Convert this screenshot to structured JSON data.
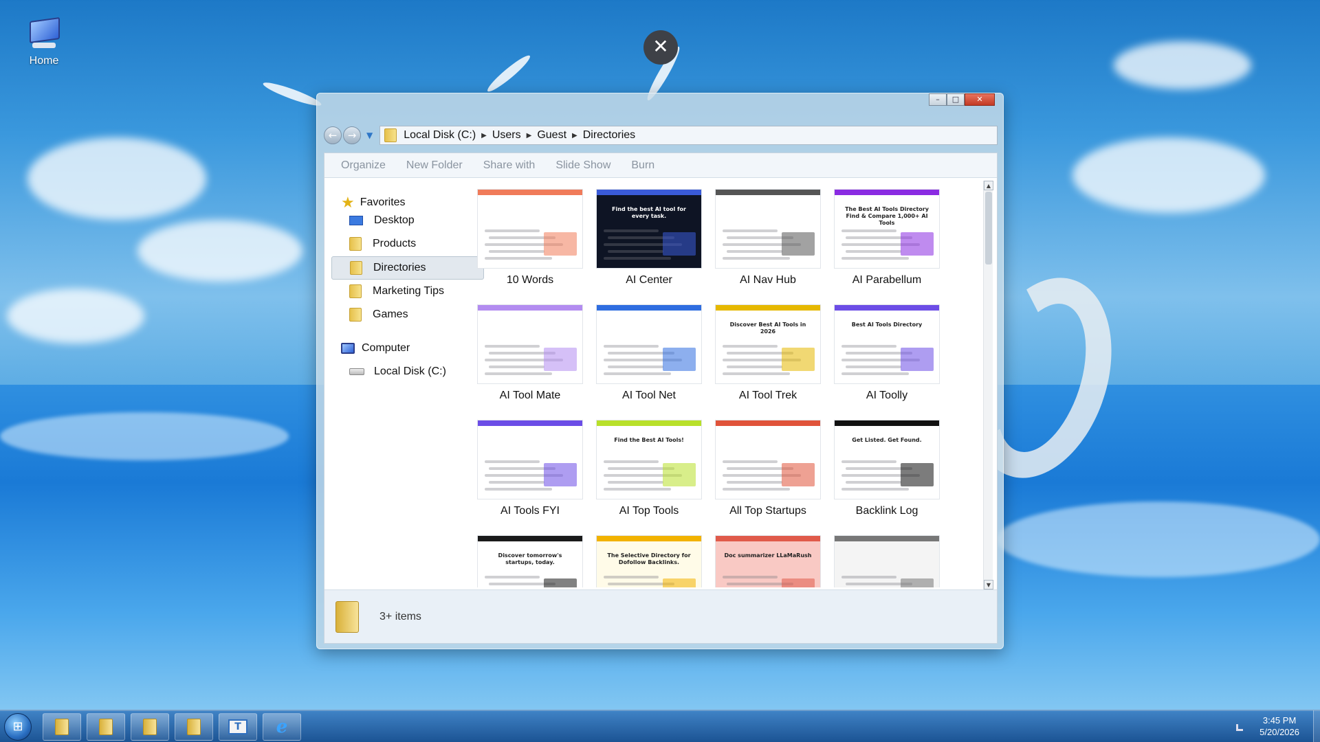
{
  "desktop": {
    "home_label": "Home"
  },
  "window": {
    "address": [
      "Local Disk (C:)",
      "Users",
      "Guest",
      "Directories"
    ],
    "toolbar": [
      "Organize",
      "New Folder",
      "Share with",
      "Slide Show",
      "Burn"
    ],
    "sidebar": {
      "favorites_label": "Favorites",
      "favorites": [
        "Desktop",
        "Products",
        "Directories",
        "Marketing Tips",
        "Games"
      ],
      "selected": "Directories",
      "computer_label": "Computer",
      "computer": [
        "Local Disk (C:)"
      ]
    },
    "items": [
      {
        "label": "10 Words",
        "thumb": {
          "accent": "#f07b5a",
          "bg": "#ffffff",
          "text": ""
        }
      },
      {
        "label": "AI Center",
        "thumb": {
          "accent": "#3a5bd8",
          "bg": "#0e1424",
          "text": "Find the best AI tool for every task."
        }
      },
      {
        "label": "AI Nav Hub",
        "thumb": {
          "accent": "#555555",
          "bg": "#ffffff",
          "text": ""
        }
      },
      {
        "label": "AI Parabellum",
        "thumb": {
          "accent": "#8a2be2",
          "bg": "#ffffff",
          "text": "The Best AI Tools Directory Find & Compare 1,000+ AI Tools"
        }
      },
      {
        "label": "AI Tool Mate",
        "thumb": {
          "accent": "#b38cf0",
          "bg": "#ffffff",
          "text": ""
        }
      },
      {
        "label": "AI Tool Net",
        "thumb": {
          "accent": "#2f6de0",
          "bg": "#ffffff",
          "text": ""
        }
      },
      {
        "label": "AI Tool Trek",
        "thumb": {
          "accent": "#e6b800",
          "bg": "#ffffff",
          "text": "Discover Best AI Tools in 2026"
        }
      },
      {
        "label": "AI Toolly",
        "thumb": {
          "accent": "#6c4de6",
          "bg": "#ffffff",
          "text": "Best AI Tools Directory"
        }
      },
      {
        "label": "AI Tools FYI",
        "thumb": {
          "accent": "#6b4de6",
          "bg": "#ffffff",
          "text": ""
        }
      },
      {
        "label": "AI Top Tools",
        "thumb": {
          "accent": "#b8e02a",
          "bg": "#ffffff",
          "text": "Find the Best AI Tools!"
        }
      },
      {
        "label": "All Top Startups",
        "thumb": {
          "accent": "#e0533a",
          "bg": "#ffffff",
          "text": ""
        }
      },
      {
        "label": "Backlink Log",
        "thumb": {
          "accent": "#111111",
          "bg": "#ffffff",
          "text": "Get Listed. Get Found."
        }
      },
      {
        "label": "",
        "thumb": {
          "accent": "#1a1a1a",
          "bg": "#ffffff",
          "text": "Discover tomorrow's startups, today."
        }
      },
      {
        "label": "",
        "thumb": {
          "accent": "#f2b200",
          "bg": "#fffbe8",
          "text": "The Selective Directory for Dofollow Backlinks."
        }
      },
      {
        "label": "",
        "thumb": {
          "accent": "#e05a4a",
          "bg": "#f9c9c4",
          "text": "Doc summarizer LLaMaRush"
        }
      },
      {
        "label": "",
        "thumb": {
          "accent": "#777777",
          "bg": "#f4f4f4",
          "text": ""
        }
      }
    ],
    "status_text": "3+ items"
  },
  "taskbar": {
    "time": "3:45 PM",
    "date": "5/20/2026",
    "buttons": [
      "folder",
      "folder",
      "folder",
      "folder",
      "text-editor",
      "internet-explorer"
    ]
  }
}
